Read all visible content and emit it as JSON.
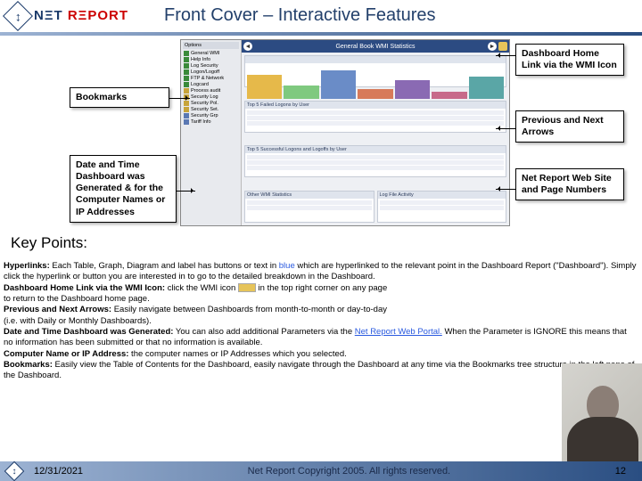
{
  "brand": {
    "text1": "NΞT ",
    "text2": "RΞPORT"
  },
  "title": "Front Cover – Interactive Features",
  "callouts": {
    "bookmarks": "Bookmarks",
    "datetime": "Date and Time Dashboard was Generated & for the Computer Names or IP Addresses",
    "dashhome": "Dashboard Home Link via the WMI Icon",
    "prevnext": "Previous and Next Arrows",
    "netreport": "Net Report Web Site and Page Numbers"
  },
  "screenshot": {
    "sidebar_header": "Options",
    "sidebar_items": [
      "General WMI",
      "Help Info",
      "Log Security",
      "Logon/Logoff",
      "FTP & Network",
      "Logcard",
      "Process audit",
      "Security Log",
      "Security Pol.",
      "Security Set.",
      "Security Grp",
      "Tariff Info"
    ],
    "main_title": "General Book WMI Statistics",
    "panels": [
      "",
      "Top 5 Failed Logons by User",
      "Top 5 Successful Logons and Logoffs by User",
      "",
      "Other WMI Statistics",
      "Log File Activity"
    ]
  },
  "key_heading": "Key Points:",
  "kp": {
    "l1a": "Hyperlinks:",
    "l1b": " Each Table, Graph, Diagram and label has buttons or text in ",
    "l1c": "blue",
    "l1d": " which are  hyperlinked to the relevant point in the Dashboard Report (\"Dashboard\"). Simply click the hyperlink or button you are interested in to go to the detailed breakdown in the Dashboard.",
    "l2a": "Dashboard Home Link via the WMI Icon:",
    "l2b": " click the WMI icon ",
    "l2c": " in the top right corner on any page",
    "l2d": " to return to the Dashboard home page.",
    "l3a": "Previous and Next Arrows:",
    "l3b": " Easily navigate between Dashboards from month-to-month or day-to-day",
    "l3c": " (i.e. with Daily or Monthly Dashboards).",
    "l4a": "Date and Time Dashboard was Generated:",
    "l4b": " You can also add additional Parameters via the ",
    "l4c": "Net Report Web Portal.",
    "l4d": " When the Parameter is IGNORE this means that no information has been submitted or that no information is available.",
    "l5a": "Computer Name or IP Address:",
    "l5b": " the computer names or IP Addresses which you selected.",
    "l6a": "Bookmarks:",
    "l6b": " Easily view the Table of Contents for the Dashboard, easily navigate through the Dashboard at any time via the Bookmarks tree structure in the left pane of the Dashboard."
  },
  "footer": {
    "date": "12/31/2021",
    "copyright": "Net Report Copyright 2005. All rights reserved.",
    "page": "12"
  }
}
